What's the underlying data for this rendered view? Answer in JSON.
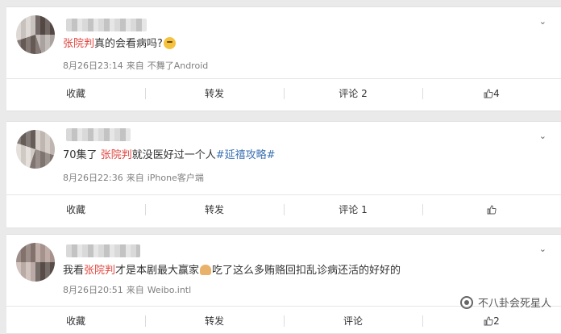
{
  "posts": [
    {
      "text_before": "",
      "highlight": "张院判",
      "text_after": "真的会看病吗?",
      "tag": "",
      "time": "8月26日23:14",
      "from_label": "来自",
      "source": "不舞了Android",
      "actions": {
        "fav": "收藏",
        "repost": "转发",
        "comment": "评论 2",
        "like": "4"
      }
    },
    {
      "text_before": "70集了 ",
      "highlight": "张院判",
      "text_after": "就没医好过一个人",
      "tag": "#延禧攻略#",
      "time": "8月26日22:36",
      "from_label": "来自",
      "source": "iPhone客户端",
      "actions": {
        "fav": "收藏",
        "repost": "转发",
        "comment": "评论 1",
        "like": ""
      }
    },
    {
      "text_before": "我看",
      "highlight": "张院判",
      "text_after": "才是本剧最大赢家",
      "text_after2": "吃了这么多贿赂回扣乱诊病还活的好好的",
      "tag": "",
      "time": "8月26日20:51",
      "from_label": "来自",
      "source": "Weibo.intl",
      "actions": {
        "fav": "收藏",
        "repost": "转发",
        "comment": "评论",
        "like": "2"
      }
    }
  ],
  "watermark": "不八卦会死星人",
  "colors": {
    "highlight": "#e0463f",
    "tag": "#3d72b3",
    "meta": "#808080"
  }
}
